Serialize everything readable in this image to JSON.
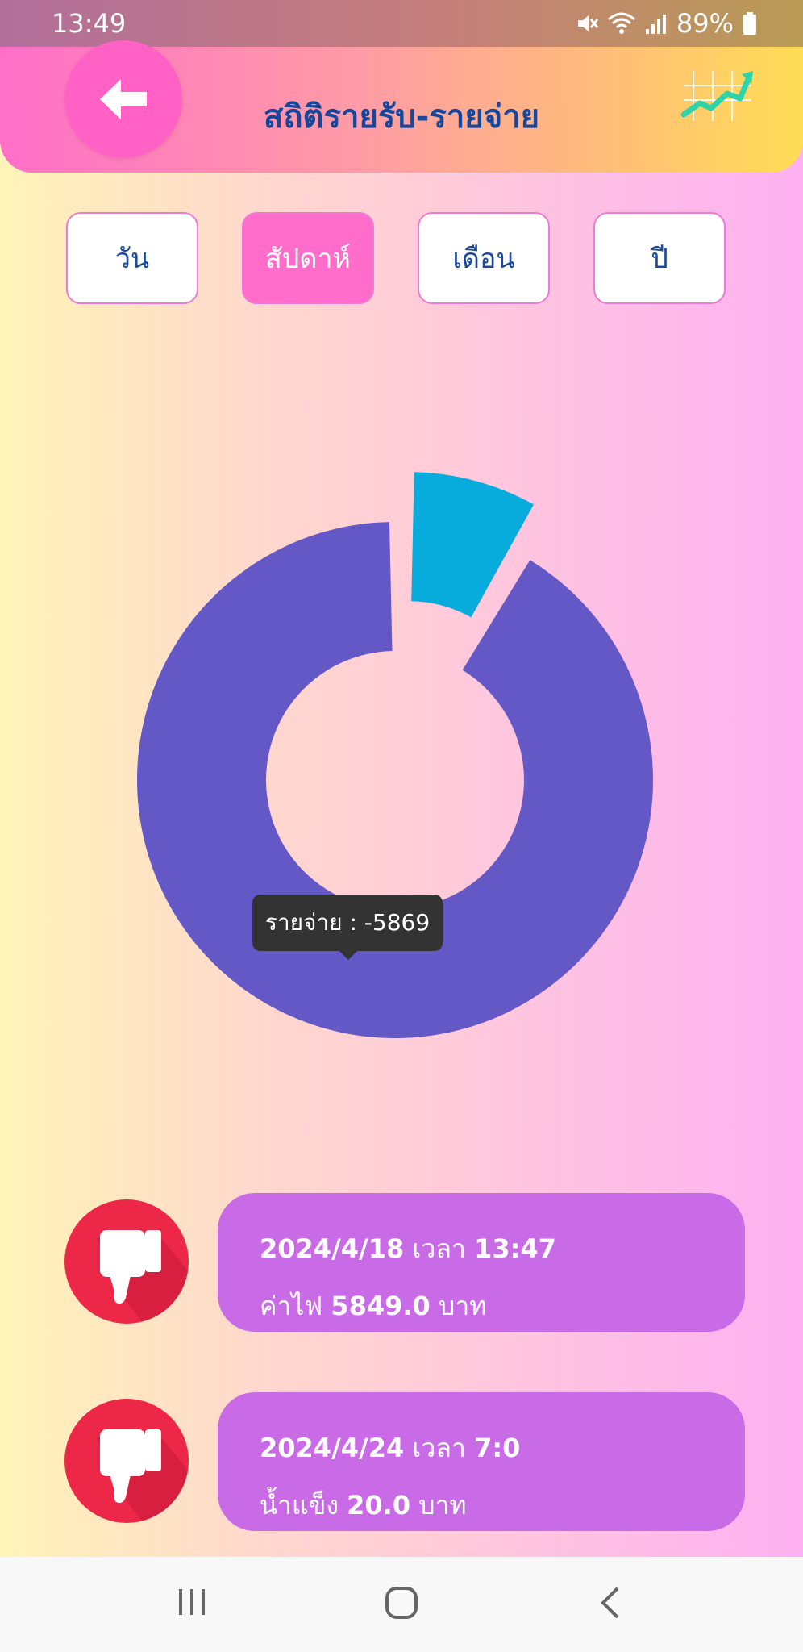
{
  "status": {
    "time": "13:49",
    "battery": "89%"
  },
  "header": {
    "title": "สถิติรายรับ-รายจ่าย",
    "back_icon": "arrow-left-icon",
    "chart_icon": "trend-chart-icon"
  },
  "tabs": [
    {
      "label": "วัน",
      "active": false
    },
    {
      "label": "สัปดาห์",
      "active": true
    },
    {
      "label": "เดือน",
      "active": false
    },
    {
      "label": "ปี",
      "active": false
    }
  ],
  "chart_data": {
    "type": "pie",
    "donut": true,
    "series": [
      {
        "name": "รายจ่าย",
        "value": 5869,
        "color": "#6457c6"
      },
      {
        "value": 539,
        "color": "#08acdc",
        "exploded": true
      }
    ],
    "tooltip": "รายจ่าย : -5869"
  },
  "transactions": [
    {
      "date": "2024/4/18",
      "time_label": "เวลา",
      "time": "13:47",
      "name": "ค่าไฟ",
      "amount": "5849.0",
      "unit": "บาท",
      "icon": "thumbs-down-icon"
    },
    {
      "date": "2024/4/24",
      "time_label": "เวลา",
      "time": "7:0",
      "name": "น้ำแข็ง",
      "amount": "20.0",
      "unit": "บาท",
      "icon": "thumbs-down-icon"
    }
  ],
  "colors": {
    "accent": "#ff6cc9",
    "card": "#c96be6",
    "expense_icon_bg": "#ec2747",
    "title": "#17479b"
  }
}
